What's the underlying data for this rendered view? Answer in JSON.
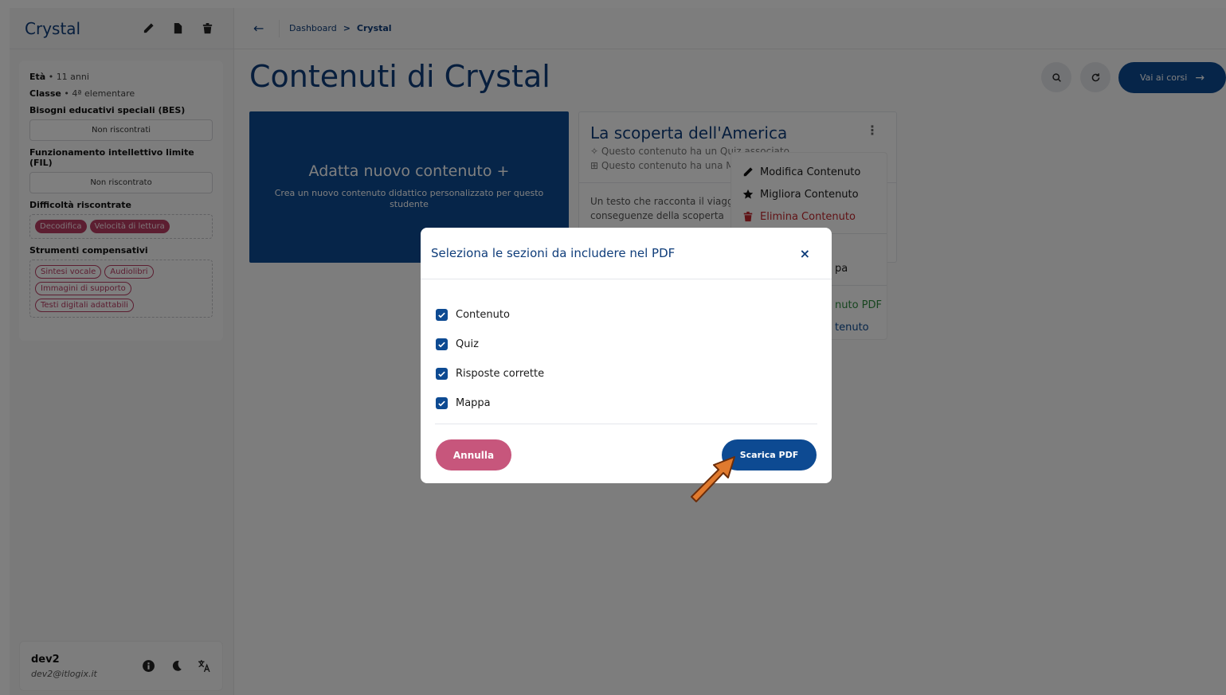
{
  "sidebar": {
    "title": "Crystal",
    "profile": {
      "age_label": "Età",
      "age_value": "• 11 anni",
      "class_label": "Classe",
      "class_value": "• 4ª elementare",
      "bes_label": "Bisogni educativi speciali (BES)",
      "bes_value": "Non riscontrati",
      "fil_label": "Funzionamento intellettivo limite (FIL)",
      "fil_value": "Non riscontrato",
      "difficulties_label": "Difficoltà riscontrate",
      "difficulties": [
        "Decodifica",
        "Velocità di lettura"
      ],
      "tools_label": "Strumenti compensativi",
      "tools": [
        "Sintesi vocale",
        "Audiolibri",
        "Immagini di supporto",
        "Testi digitali adattabili"
      ]
    },
    "user": {
      "name": "dev2",
      "email": "dev2@itlogix.it"
    }
  },
  "topbar": {
    "breadcrumb_root": "Dashboard",
    "breadcrumb_sep": ">",
    "breadcrumb_current": "Crystal"
  },
  "main": {
    "title": "Contenuti di Crystal",
    "go_button": "Vai ai corsi",
    "new_card": {
      "title": "Adatta nuovo contenuto +",
      "subtitle": "Crea un nuovo contenuto didattico personalizzato per questo studente"
    },
    "content_card": {
      "title": "La scoperta dell'America",
      "line1": "Questo contenuto ha un Quiz associato",
      "line2": "Questo contenuto ha una Mappa associata",
      "description": "Un testo che racconta il viaggio di Colombo e le conseguenze della scoperta"
    },
    "menu": {
      "edit": "Modifica Contenuto",
      "improve": "Migliora Contenuto",
      "delete": "Elimina Contenuto",
      "partial_mappa": "pa",
      "partial_pdf": "nuto PDF",
      "partial_content": "tenuto"
    }
  },
  "modal": {
    "title": "Seleziona le sezioni da includere nel PDF",
    "close": "×",
    "options": [
      {
        "label": "Contenuto",
        "checked": true
      },
      {
        "label": "Quiz",
        "checked": true
      },
      {
        "label": "Risposte corrette",
        "checked": true
      },
      {
        "label": "Mappa",
        "checked": true
      }
    ],
    "cancel": "Annulla",
    "download": "Scarica PDF"
  },
  "colors": {
    "primary": "#0d4a92",
    "danger": "#c0262d",
    "chip": "#b83c63",
    "cancel_button": "#c7567c",
    "annotation_arrow": "#e07a2e"
  }
}
